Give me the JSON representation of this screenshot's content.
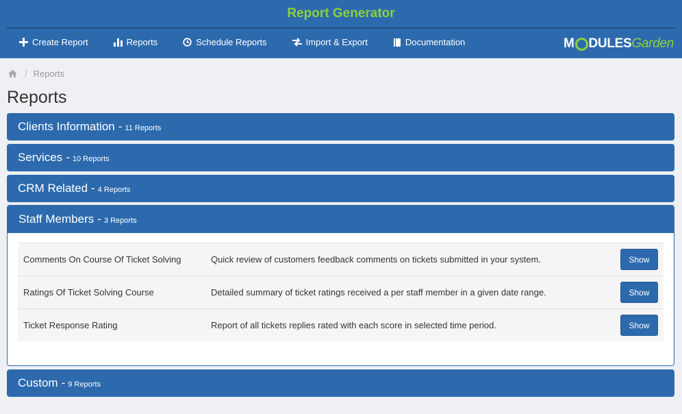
{
  "header": {
    "title": "Report Generator",
    "nav": [
      {
        "label": "Create Report",
        "icon": "plus-icon"
      },
      {
        "label": "Reports",
        "icon": "bar-chart-icon"
      },
      {
        "label": "Schedule Reports",
        "icon": "clock-icon"
      },
      {
        "label": "Import & Export",
        "icon": "exchange-icon"
      },
      {
        "label": "Documentation",
        "icon": "book-icon"
      }
    ],
    "logo": {
      "part1": "M",
      "part2": "DULES",
      "part3": "Garden"
    }
  },
  "breadcrumb": {
    "current": "Reports"
  },
  "page_title": "Reports",
  "categories": [
    {
      "name": "Clients Information",
      "count": "11 Reports"
    },
    {
      "name": "Services",
      "count": "10 Reports"
    },
    {
      "name": "CRM Related",
      "count": "4 Reports"
    },
    {
      "name": "Staff Members",
      "count": "3 Reports"
    },
    {
      "name": "Custom",
      "count": "9 Reports"
    }
  ],
  "staff_reports": [
    {
      "name": "Comments On Course Of Ticket Solving",
      "description": "Quick review of customers feedback comments on tickets submitted in your system.",
      "action": "Show"
    },
    {
      "name": "Ratings Of Ticket Solving Course",
      "description": "Detailed summary of ticket ratings received a per staff member in a given date range.",
      "action": "Show"
    },
    {
      "name": "Ticket Response Rating",
      "description": "Report of all tickets replies rated with each score in selected time period.",
      "action": "Show"
    }
  ],
  "colors": {
    "header": "#2d6aad",
    "accent": "#8bd13c"
  }
}
